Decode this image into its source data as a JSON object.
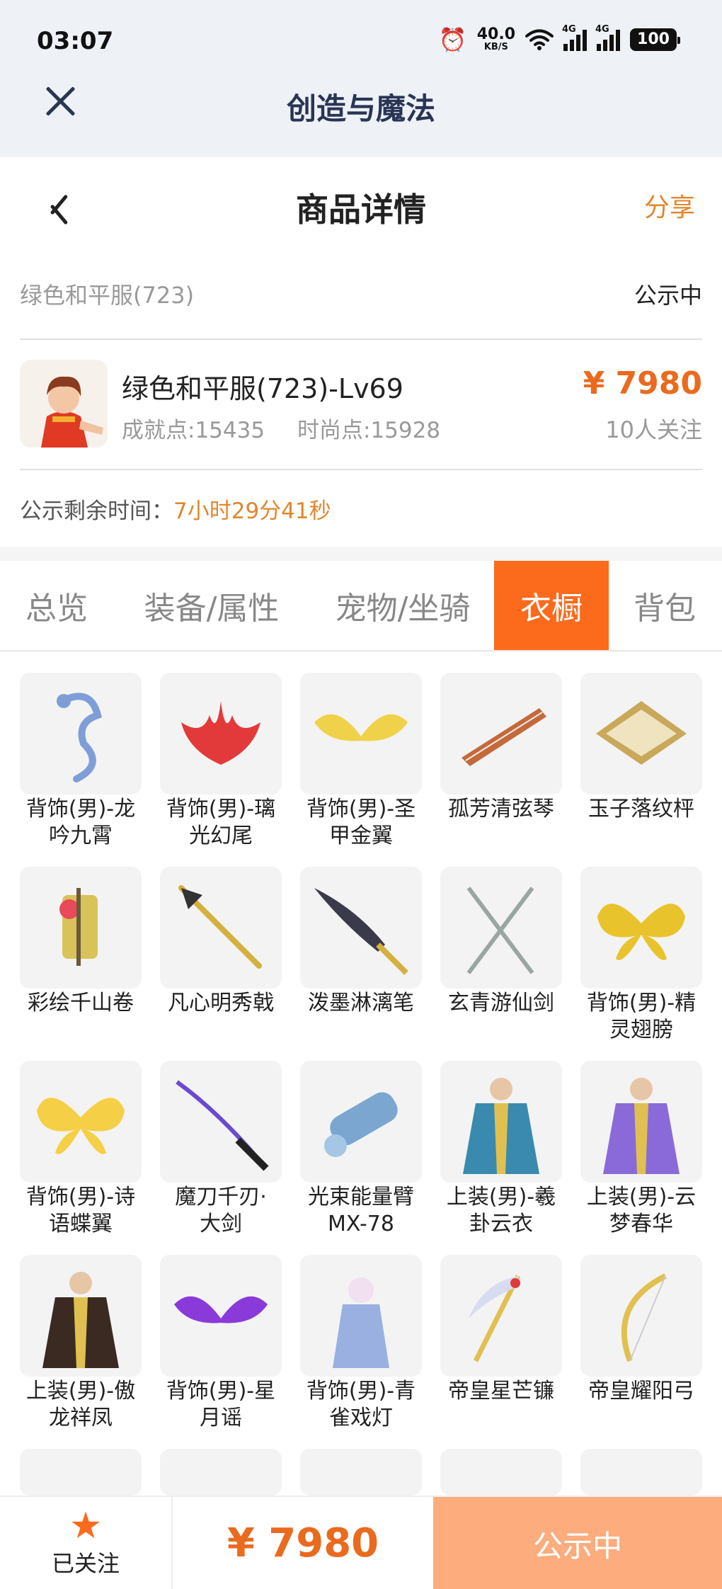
{
  "status_bar": {
    "time": "03:07",
    "net_speed": "40.0",
    "net_unit": "KB/S",
    "signal1_tag": "4G",
    "signal2_tag": "4G",
    "battery": "100"
  },
  "app_bar": {
    "title": "创造与魔法"
  },
  "header": {
    "title": "商品详情",
    "share_label": "分享"
  },
  "item": {
    "short_name": "绿色和平服(723)",
    "status": "公示中",
    "full_name": "绿色和平服(723)-Lv69",
    "achievement": "成就点:15435",
    "fashion": "时尚点:15928",
    "price": "¥ 7980",
    "followers": "10人关注",
    "countdown_label": "公示剩余时间：",
    "countdown_value": "7小时29分41秒"
  },
  "tabs": [
    {
      "label": "总览",
      "active": false
    },
    {
      "label": "装备/属性",
      "active": false
    },
    {
      "label": "宠物/坐骑",
      "active": false
    },
    {
      "label": "衣橱",
      "active": true
    },
    {
      "label": "背包",
      "active": false
    }
  ],
  "wardrobe": [
    {
      "line1": "背饰(男)-龙",
      "line2": "吟九霄",
      "icon": "dragon-icon",
      "color": "#7f9ed8"
    },
    {
      "line1": "背饰(男)-璃",
      "line2": "光幻尾",
      "icon": "flame-tail-icon",
      "color": "#e23a3a"
    },
    {
      "line1": "背饰(男)-圣",
      "line2": "甲金翼",
      "icon": "golden-wings-icon",
      "color": "#f0d24a"
    },
    {
      "line1": "孤芳清弦琴",
      "line2": "",
      "icon": "qin-instrument-icon",
      "color": "#c46a3a"
    },
    {
      "line1": "玉子落纹枰",
      "line2": "",
      "icon": "go-board-icon",
      "color": "#c9a85a"
    },
    {
      "line1": "彩绘千山卷",
      "line2": "",
      "icon": "scroll-icon",
      "color": "#d8c25a"
    },
    {
      "line1": "凡心明秀戟",
      "line2": "",
      "icon": "halberd-icon",
      "color": "#d4b040"
    },
    {
      "line1": "泼墨淋漓笔",
      "line2": "",
      "icon": "brush-icon",
      "color": "#3a3a4a"
    },
    {
      "line1": "玄青游仙剑",
      "line2": "",
      "icon": "twin-swords-icon",
      "color": "#9aa6a0"
    },
    {
      "line1": "背饰(男)-精",
      "line2": "灵翅膀",
      "icon": "butterfly-wings-icon",
      "color": "#e8c32c"
    },
    {
      "line1": "背饰(男)-诗",
      "line2": "语蝶翼",
      "icon": "butterfly-icon",
      "color": "#f5cf45"
    },
    {
      "line1": "魔刀千刃·",
      "line2": "大剑",
      "icon": "katana-icon",
      "color": "#6a4ad0"
    },
    {
      "line1": "光束能量臂",
      "line2": "MX-78",
      "icon": "energy-arm-icon",
      "color": "#7aa6d0"
    },
    {
      "line1": "上装(男)-羲",
      "line2": "卦云衣",
      "icon": "robe-icon",
      "color": "#3a8ab0"
    },
    {
      "line1": "上装(男)-云",
      "line2": "梦春华",
      "icon": "robe-icon",
      "color": "#8a6ad8"
    },
    {
      "line1": "上装(男)-傲",
      "line2": "龙祥凤",
      "icon": "armor-icon",
      "color": "#3a2a22"
    },
    {
      "line1": "背饰(男)-星",
      "line2": "月谣",
      "icon": "purple-wings-icon",
      "color": "#8a3ad8"
    },
    {
      "line1": "背饰(男)-青",
      "line2": "雀戏灯",
      "icon": "lantern-icon",
      "color": "#9ab0e0"
    },
    {
      "line1": "帝皇星芒镰",
      "line2": "",
      "icon": "scythe-icon",
      "color": "#e0c050"
    },
    {
      "line1": "帝皇耀阳弓",
      "line2": "",
      "icon": "bow-icon",
      "color": "#e0c050"
    }
  ],
  "bottom": {
    "follow_icon": "star-icon",
    "follow_label": "已关注",
    "price": "¥ 7980",
    "status": "公示中"
  }
}
